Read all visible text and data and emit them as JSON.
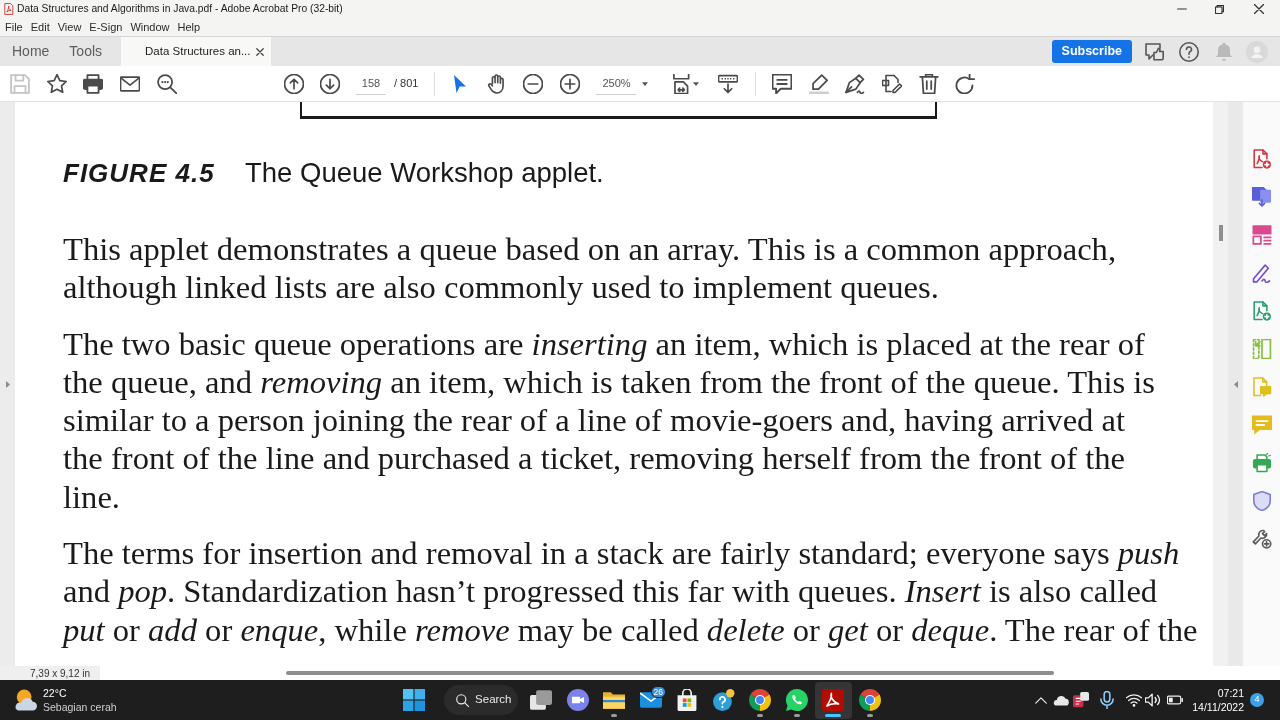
{
  "window": {
    "title": "Data Structures and Algorithms in Java.pdf - Adobe Acrobat Pro (32-bit)"
  },
  "menu": [
    "File",
    "Edit",
    "View",
    "E-Sign",
    "Window",
    "Help"
  ],
  "tabs": [
    {
      "label": "Home",
      "selected": false,
      "closable": false
    },
    {
      "label": "Tools",
      "selected": false,
      "closable": false
    },
    {
      "label": "Data Structures an...",
      "selected": true,
      "closable": true
    }
  ],
  "subscribe_button": "Subscribe",
  "toolbar": {
    "save_disabled": true,
    "pointer_tools": [
      {
        "kind": "select",
        "selected": true
      },
      {
        "kind": "hand",
        "selected": false
      }
    ],
    "page_number": "158",
    "page_total": "/ 801",
    "zoom": "250%"
  },
  "document": {
    "figure_label": "FIGURE 4.5",
    "figure_caption": "The Queue Workshop applet.",
    "paragraphs": [
      {
        "lines": [
          "This applet demonstrates a queue based on an array. This is a common approach,",
          "although linked lists are also commonly used to implement queues."
        ]
      },
      {
        "lines": [
          "The two basic queue operations are *inserting* an item, which is placed at the rear of",
          "the queue, and *removing* an item, which is taken from the front of the queue. This is",
          "similar to a person joining the rear of a line of movie-goers and, having arrived at",
          "the front of the line and purchased a ticket, removing herself from the front of the",
          "line."
        ]
      },
      {
        "lines": [
          "The terms for insertion and removal in a stack are fairly standard; everyone says *push*",
          "and *pop*. Standardization hasn’t progressed this far with queues. *Insert* is also called",
          "*put* or *add* or *enque*, while *remove* may be called *delete* or *get* or *deque*. The rear of the"
        ]
      }
    ]
  },
  "status_bar": {
    "page_size": "7,39 x 9,12 in"
  },
  "taskbar": {
    "weather": {
      "temperature": "22°C",
      "condition": "Sebagian cerah"
    },
    "apps": [
      {
        "kind": "start",
        "selected": false,
        "running": false
      },
      {
        "kind": "search",
        "label": "Search",
        "selected": false,
        "running": false
      },
      {
        "kind": "task-view",
        "selected": false,
        "running": false
      },
      {
        "kind": "chat",
        "selected": false,
        "running": false
      },
      {
        "kind": "file-explorer",
        "selected": false,
        "running": true
      },
      {
        "kind": "mail",
        "selected": false,
        "running": false,
        "badge": "26"
      },
      {
        "kind": "store",
        "selected": false,
        "running": false
      },
      {
        "kind": "tips",
        "selected": false,
        "running": false
      },
      {
        "kind": "chrome",
        "selected": false,
        "running": true
      },
      {
        "kind": "whatsapp",
        "selected": false,
        "running": true
      },
      {
        "kind": "acrobat",
        "selected": true,
        "running": true
      },
      {
        "kind": "chrome",
        "selected": false,
        "running": true
      }
    ],
    "clock": {
      "time": "07:21",
      "date": "14/11/2022"
    },
    "notification_count": "4"
  }
}
